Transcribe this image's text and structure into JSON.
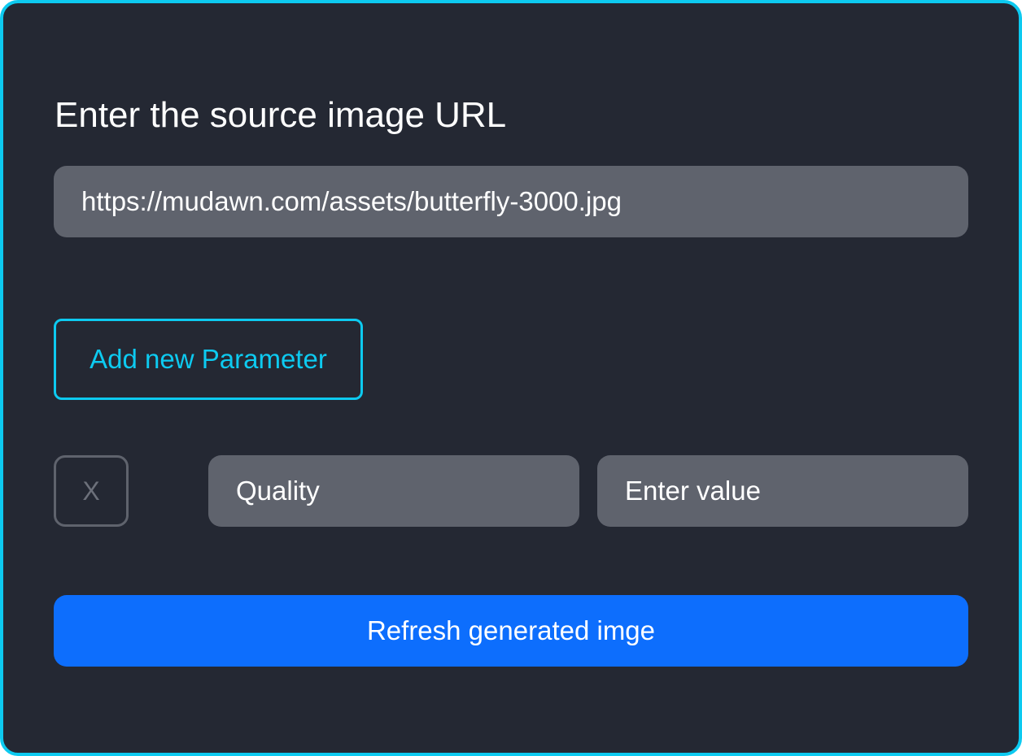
{
  "form": {
    "title": "Enter the source image URL",
    "source_url": {
      "value": "https://mudawn.com/assets/butterfly-3000.jpg"
    },
    "add_parameter_label": "Add new Parameter",
    "parameters": [
      {
        "remove_label": "X",
        "name_value": "Quality",
        "value_placeholder": "Enter value"
      }
    ],
    "refresh_label": "Refresh generated imge"
  },
  "colors": {
    "panel_background": "#242833",
    "accent_border": "#0dcaf0",
    "input_background": "#5f636d",
    "primary_button": "#0d6efd"
  }
}
